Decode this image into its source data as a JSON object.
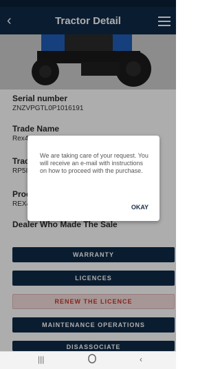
{
  "header": {
    "title": "Tractor Detail",
    "back_icon": "chevron-left-icon",
    "menu_icon": "hamburger-menu-icon"
  },
  "fields": {
    "serial_label": "Serial number",
    "serial_value": "ZNZVPGTL0P1016191",
    "trade_label": "Trade Name",
    "trade_value": "Rex4",
    "tractor_label": "Trac",
    "tractor_value": "RP5I",
    "product_label": "Proc",
    "product_value": "REX4",
    "dealer_label": "Dealer Who Made The Sale"
  },
  "buttons": {
    "warranty": "WARRANTY",
    "licences": "LICENCES",
    "renew": "RENEW THE LICENCE",
    "maintenance": "MAINTENANCE OPERATIONS",
    "disassociate": "DISASSOCIATE"
  },
  "dialog": {
    "message": "We are taking care of your request. You will receive an e-mail with instructions on how to proceed with the purchase.",
    "ok_label": "OKAY"
  },
  "nav": {
    "recents_icon": "recent-apps-icon",
    "home_icon": "home-icon",
    "back_icon": "nav-back-icon"
  },
  "colors": {
    "primary": "#0f2a48",
    "danger_text": "#c0392b"
  }
}
